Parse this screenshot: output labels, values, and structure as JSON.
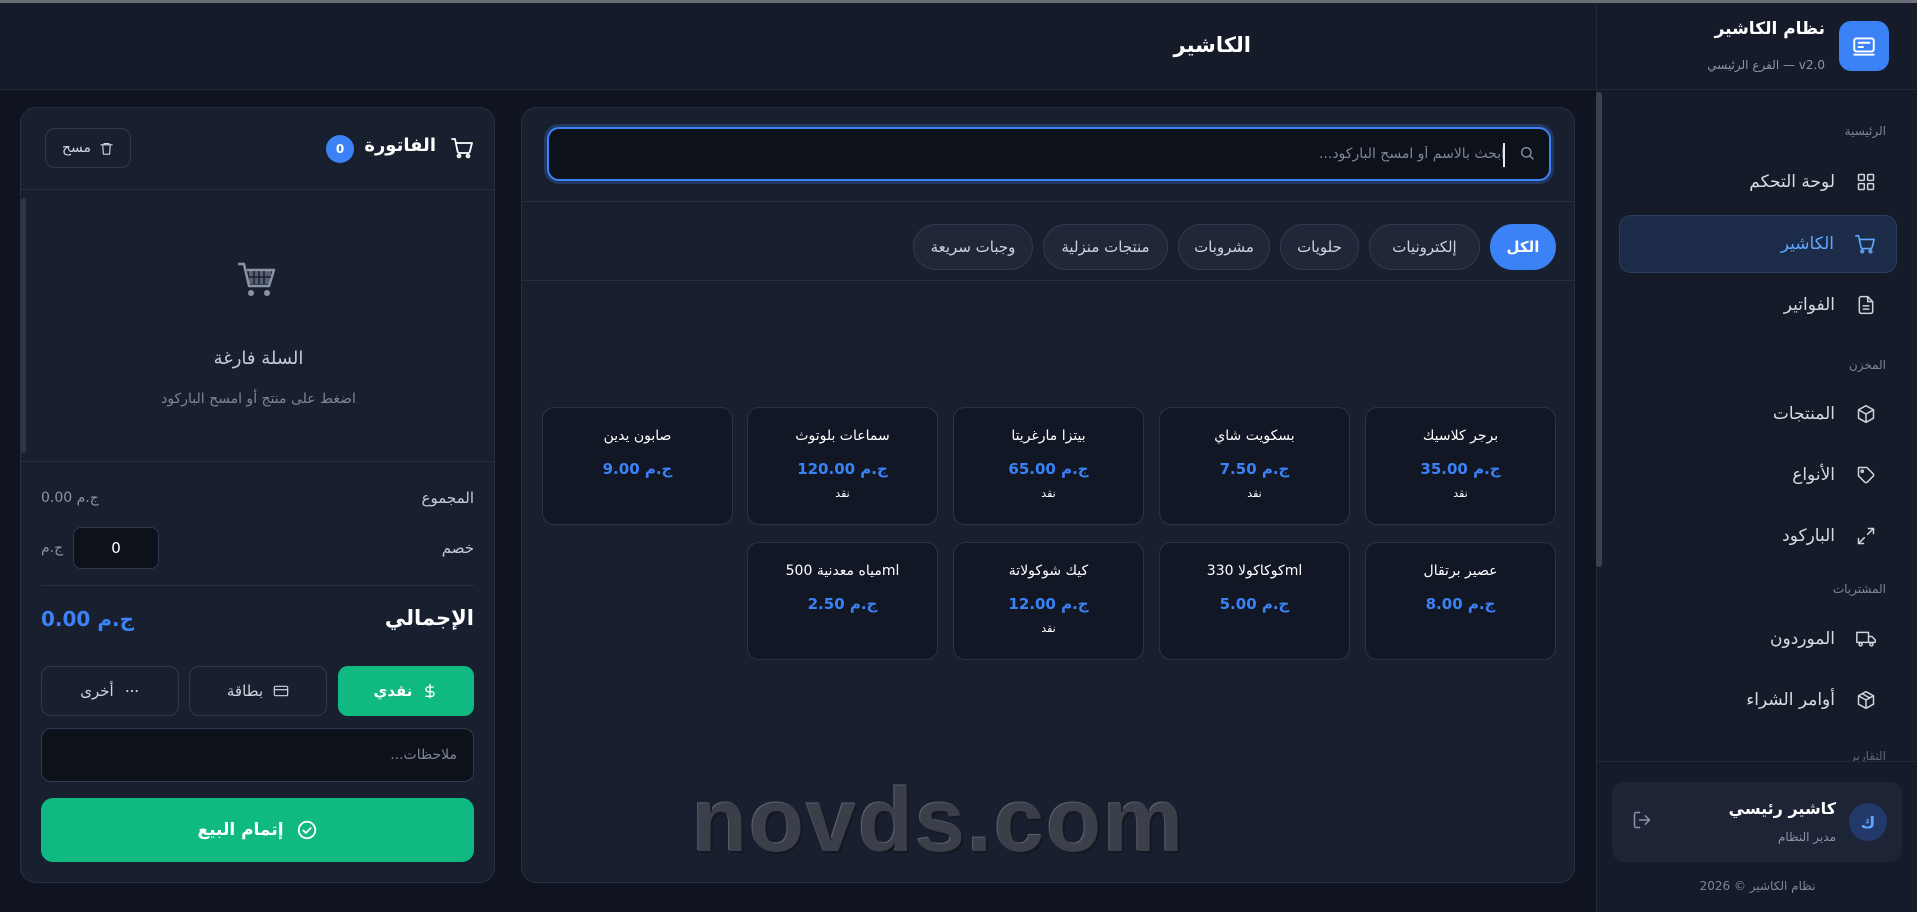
{
  "brand": {
    "title": "نظام الكاشير",
    "subtitle": "الفرع الرئيسي — v2.0"
  },
  "header": {
    "page_title": "الكاشير"
  },
  "sidebar": {
    "sections": {
      "main": "الرئيسية",
      "inventory": "المخزن",
      "purchases": "المشتريات",
      "reports": "التقارير"
    },
    "items": [
      {
        "label": "لوحة التحكم",
        "icon": "grid-icon"
      },
      {
        "label": "الكاشير",
        "icon": "cart-icon",
        "active": true
      },
      {
        "label": "الفواتير",
        "icon": "file-icon"
      },
      {
        "label": "المنتجات",
        "icon": "box-icon"
      },
      {
        "label": "الأنواع",
        "icon": "tag-icon"
      },
      {
        "label": "الباركود",
        "icon": "expand-icon"
      },
      {
        "label": "الموردون",
        "icon": "truck-icon"
      },
      {
        "label": "أوامر الشراء",
        "icon": "package-icon"
      }
    ],
    "user": {
      "avatar": "ك",
      "name": "كاشير رئيسي",
      "role": "مدير النظام"
    },
    "copyright": "نظام الكاشير © 2026"
  },
  "search": {
    "placeholder": "ابحث بالاسم أو امسح الباركود...",
    "value": ""
  },
  "categories": [
    "الكل",
    "إلكترونيات",
    "حلويات",
    "مشروبات",
    "منتجات منزلية",
    "وجبات سريعة"
  ],
  "products": [
    {
      "name": "برجر كلاسيك",
      "price": "35.00 ج.م",
      "tag": "نقد"
    },
    {
      "name": "بسكويت شاي",
      "price": "7.50 ج.م",
      "tag": "نقد"
    },
    {
      "name": "بيتزا مارغريتا",
      "price": "65.00 ج.م",
      "tag": "نقد"
    },
    {
      "name": "سماعات بلوتوث",
      "price": "120.00 ج.م",
      "tag": "نقد"
    },
    {
      "name": "صابون يدين",
      "price": "9.00 ج.م",
      "tag": ""
    },
    {
      "name": "عصير برتقال",
      "price": "8.00 ج.م",
      "tag": ""
    },
    {
      "name": "كوكاكولا 330ml",
      "price": "5.00 ج.م",
      "tag": ""
    },
    {
      "name": "كيك شوكولاتة",
      "price": "12.00 ج.م",
      "tag": "نقد"
    },
    {
      "name": "مياه معدنية 500ml",
      "price": "2.50 ج.م",
      "tag": ""
    }
  ],
  "invoice": {
    "title": "الفاتورة",
    "count": "0",
    "clear_label": "مسح",
    "empty_title": "السلة فارغة",
    "empty_sub": "اضغط على منتج أو امسح الباركود",
    "subtotal_label": "المجموع",
    "subtotal_value": "0.00 ج.م",
    "discount_label": "خصم",
    "discount_value": "0",
    "discount_unit": "ج.م",
    "total_label": "الإجمالي",
    "total_value": "0.00 ج.م",
    "payment_methods": [
      {
        "label": "نقدي",
        "icon": "dollar-icon",
        "active": true
      },
      {
        "label": "بطاقة",
        "icon": "card-icon"
      },
      {
        "label": "أخرى",
        "icon": "dots-icon"
      }
    ],
    "notes_placeholder": "ملاحظات...",
    "complete_label": "إتمام البيع"
  },
  "watermark": "novds.com",
  "colors": {
    "accent": "#3b82f6",
    "success": "#10b981",
    "background": "#0f1420",
    "panel": "#182030"
  }
}
